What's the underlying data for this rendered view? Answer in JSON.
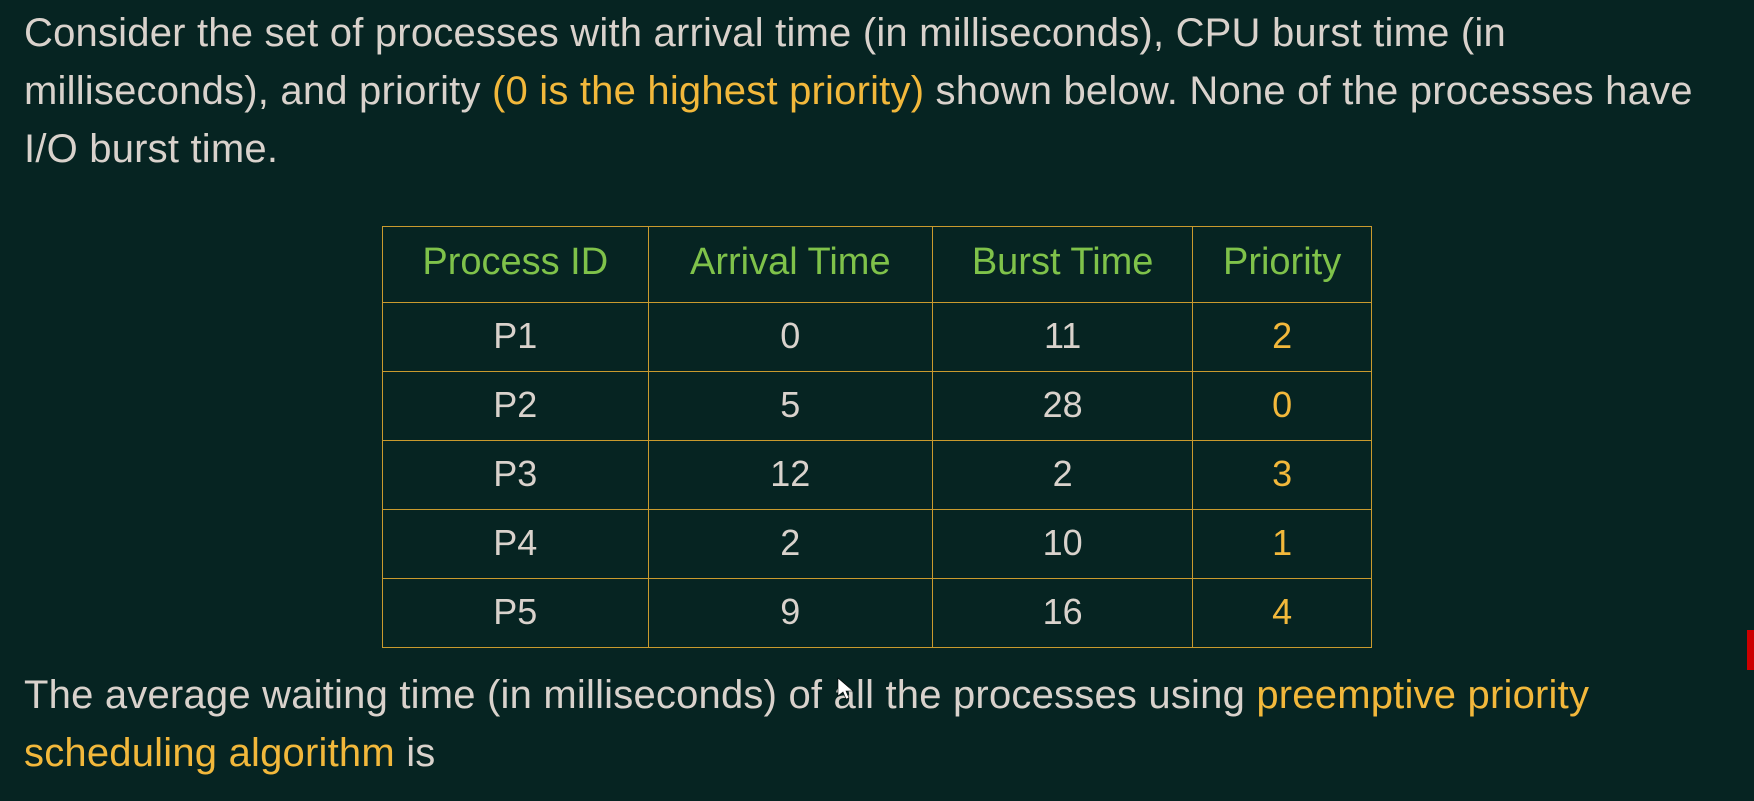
{
  "intro": {
    "seg1": "Consider the set of processes with arrival time (in milliseconds), CPU burst time (in milliseconds), and priority ",
    "highlight": "(0 is the highest priority)",
    "seg2": " shown below. None of the processes have I/O burst time."
  },
  "table": {
    "headers": [
      "Process ID",
      "Arrival Time",
      "Burst Time",
      "Priority"
    ],
    "rows": [
      {
        "id": "P1",
        "arrival": "0",
        "burst": "11",
        "priority": "2"
      },
      {
        "id": "P2",
        "arrival": "5",
        "burst": "28",
        "priority": "0"
      },
      {
        "id": "P3",
        "arrival": "12",
        "burst": "2",
        "priority": "3"
      },
      {
        "id": "P4",
        "arrival": "2",
        "burst": "10",
        "priority": "1"
      },
      {
        "id": "P5",
        "arrival": "9",
        "burst": "16",
        "priority": "4"
      }
    ]
  },
  "outro": {
    "seg1": "The average waiting time (in milliseconds) of all the processes using ",
    "highlight": "preemptive priority scheduling algorithm",
    "seg2": " is"
  },
  "chart_data": {
    "type": "table",
    "title": "Process scheduling parameters",
    "columns": [
      "Process ID",
      "Arrival Time",
      "Burst Time",
      "Priority"
    ],
    "rows": [
      [
        "P1",
        0,
        11,
        2
      ],
      [
        "P2",
        5,
        28,
        0
      ],
      [
        "P3",
        12,
        2,
        3
      ],
      [
        "P4",
        2,
        10,
        1
      ],
      [
        "P5",
        9,
        16,
        4
      ]
    ],
    "note": "Priority 0 is highest"
  }
}
